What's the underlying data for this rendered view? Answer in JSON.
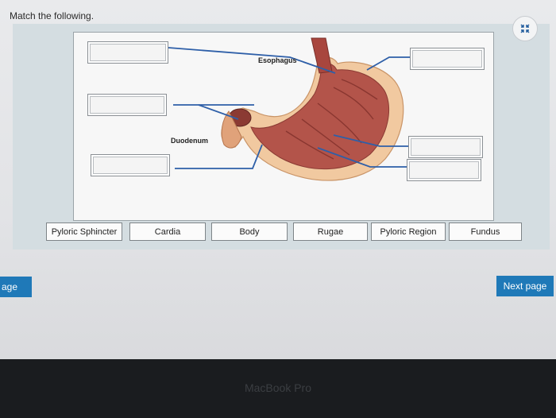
{
  "instruction": "Match the following.",
  "diagram_labels": {
    "esophagus": "Esophagus",
    "duodenum": "Duodenum"
  },
  "answer_choices": [
    "Pyloric Sphincter",
    "Cardia",
    "Body",
    "Rugae",
    "Pyloric Region",
    "Fundus"
  ],
  "navigation": {
    "prev_label": "Prev page",
    "prev_visible": "age",
    "next_label": "Next page"
  },
  "bezel_text": "MacBook Pro",
  "colors": {
    "accent": "#1f79b8",
    "leader_line": "#2e5fa8"
  },
  "icons": {
    "fullscreen": "collapse-arrows-icon"
  }
}
